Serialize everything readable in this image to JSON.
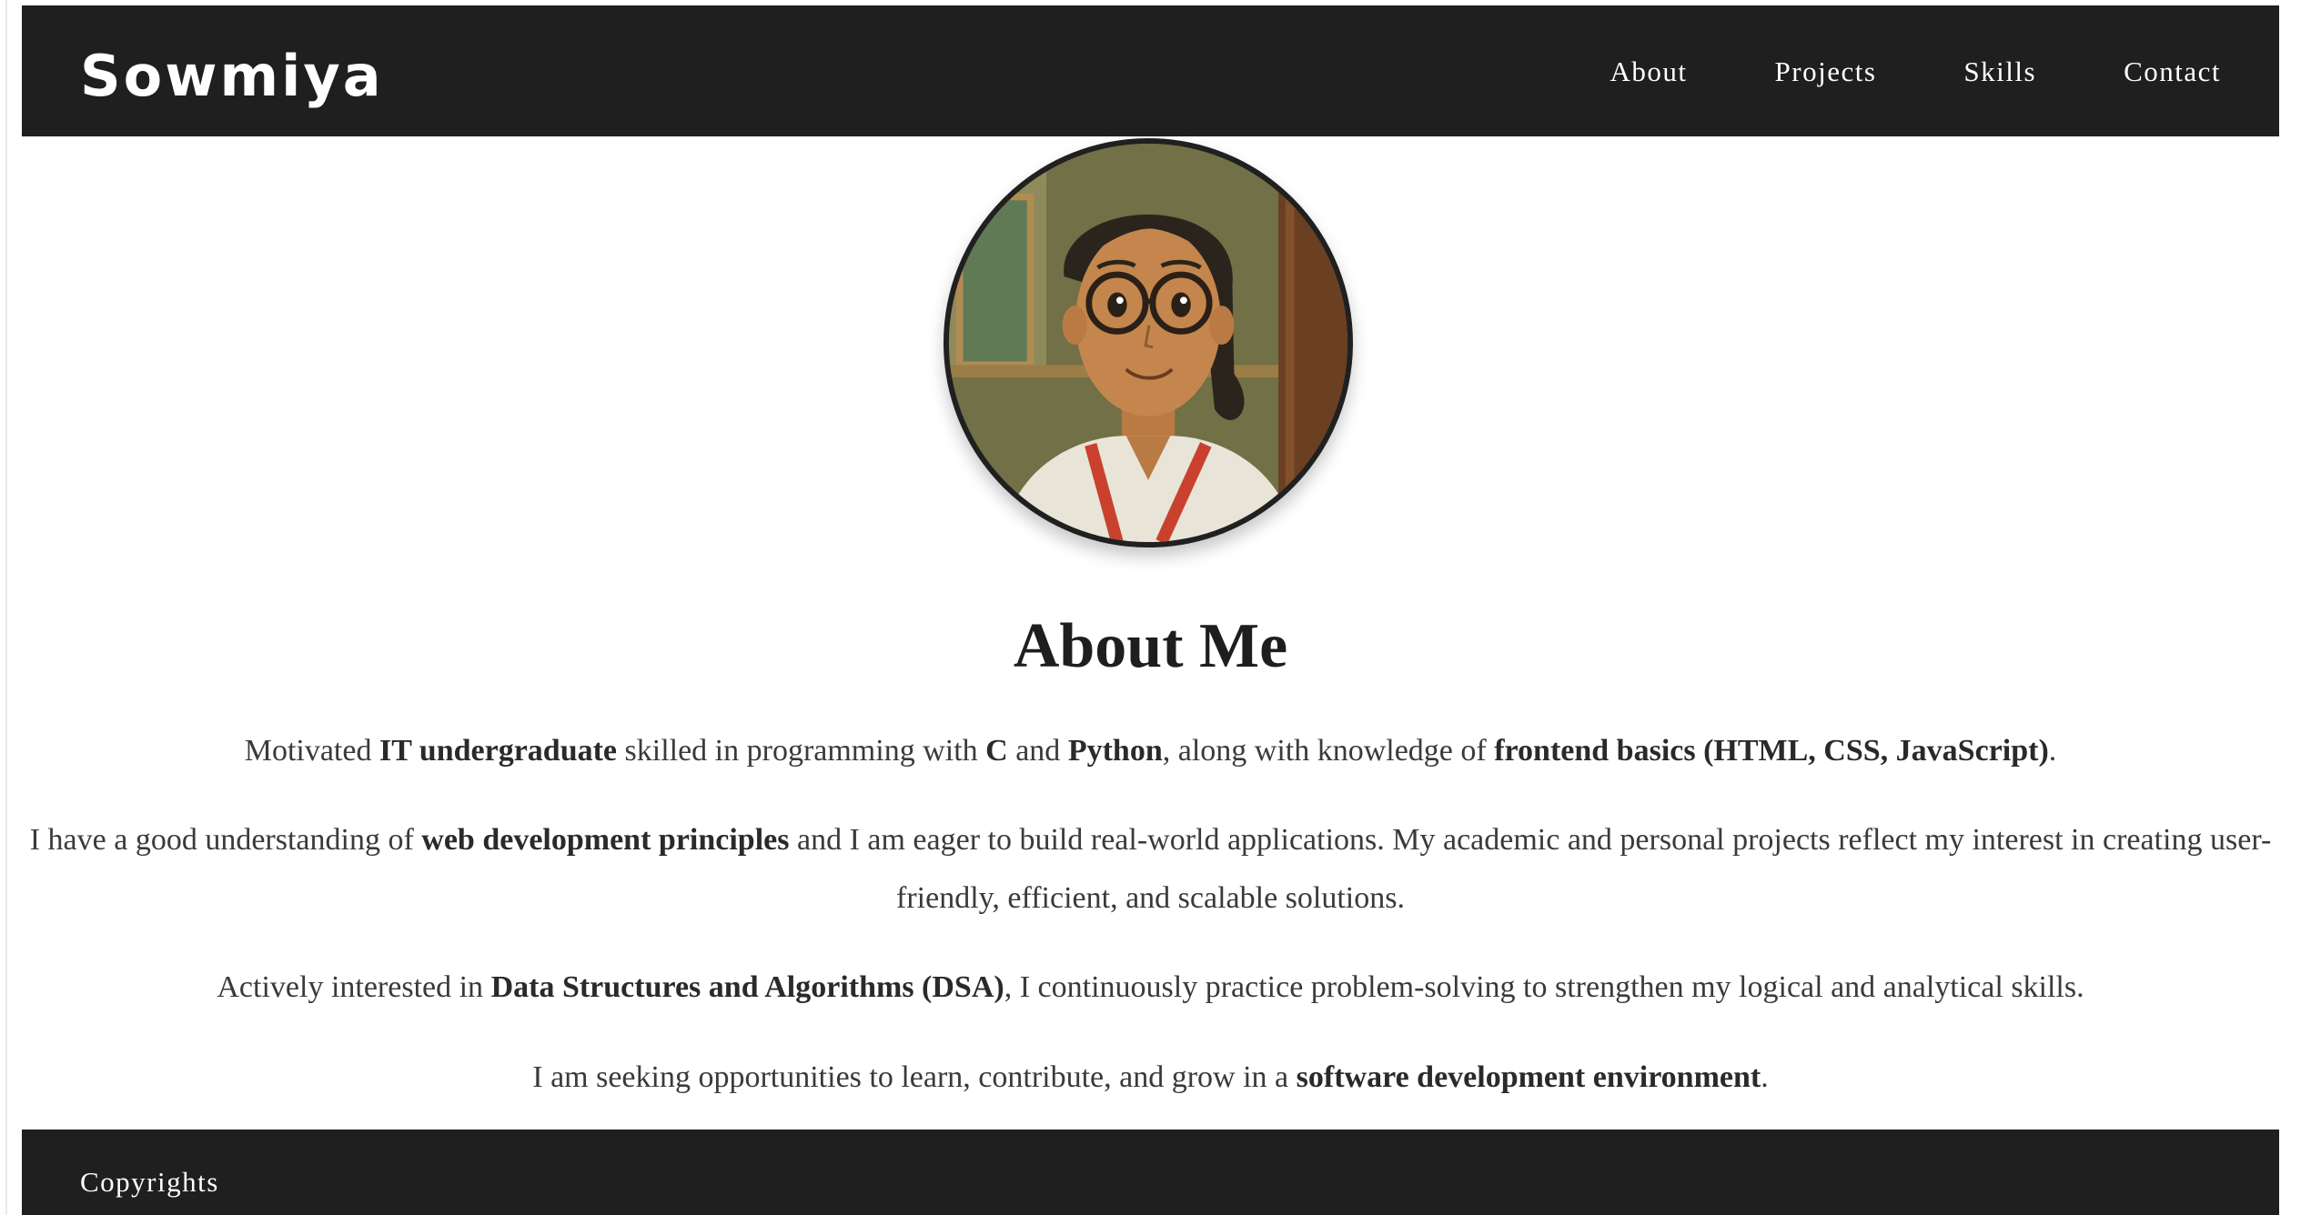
{
  "header": {
    "brand": "Sowmiya",
    "nav": [
      "About",
      "Projects",
      "Skills",
      "Contact"
    ]
  },
  "avatar": {
    "icon": "portrait-illustration"
  },
  "about": {
    "title": "About Me",
    "p1": {
      "t0": "Motivated ",
      "b0": "IT undergraduate",
      "t1": " skilled in programming with ",
      "b1": "C",
      "t2": " and ",
      "b2": "Python",
      "t3": ", along with knowledge of ",
      "b3": "frontend basics (HTML, CSS, JavaScript)",
      "t4": "."
    },
    "p2": {
      "t0": "I have a good understanding of ",
      "b0": "web development principles",
      "t1": " and I am eager to build real-world applications. My academic and personal projects reflect my interest in creating user-friendly, efficient, and scalable solutions."
    },
    "p3": {
      "t0": "Actively interested in ",
      "b0": "Data Structures and Algorithms (DSA)",
      "t1": ", I continuously practice problem-solving to strengthen my logical and analytical skills."
    },
    "p4": {
      "t0": "I am seeking opportunities to learn, contribute, and grow in a ",
      "b0": "software development environment",
      "t1": "."
    }
  },
  "footer": {
    "text": "Copyrights"
  },
  "colors": {
    "bar": "#1f1f1f",
    "text": "#3a3a3a",
    "heading": "#1e1e1e"
  }
}
